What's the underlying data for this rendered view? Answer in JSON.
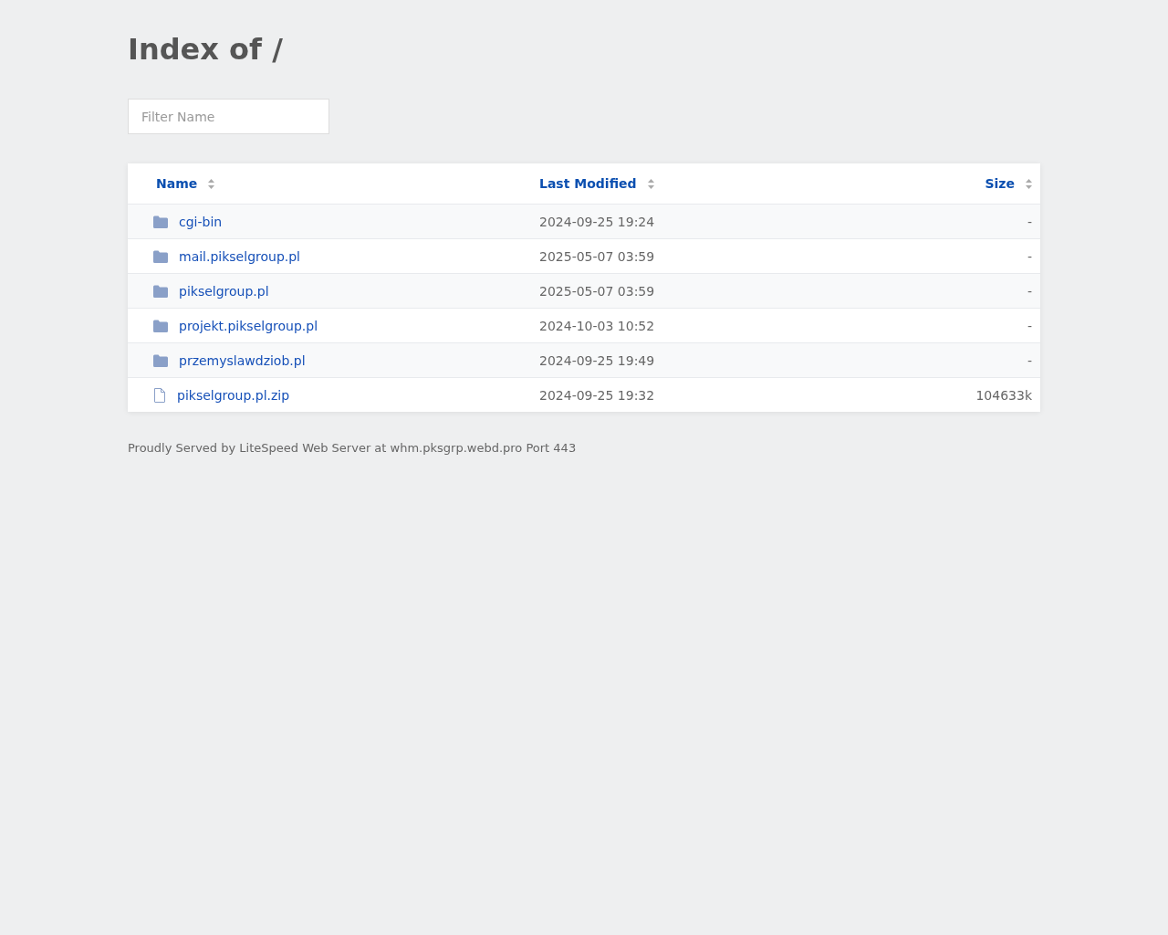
{
  "title": "Index of /",
  "filter": {
    "placeholder": "Filter Name"
  },
  "table": {
    "columns": [
      "Name",
      "Last Modified",
      "Size"
    ],
    "rows": [
      {
        "kind": "folder",
        "name": "cgi-bin",
        "modified": "2024-09-25 19:24",
        "size": "-"
      },
      {
        "kind": "folder",
        "name": "mail.pikselgroup.pl",
        "modified": "2025-05-07 03:59",
        "size": "-"
      },
      {
        "kind": "folder",
        "name": "pikselgroup.pl",
        "modified": "2025-05-07 03:59",
        "size": "-"
      },
      {
        "kind": "folder",
        "name": "projekt.pikselgroup.pl",
        "modified": "2024-10-03 10:52",
        "size": "-"
      },
      {
        "kind": "folder",
        "name": "przemyslawdziob.pl",
        "modified": "2024-09-25 19:49",
        "size": "-"
      },
      {
        "kind": "file",
        "name": "pikselgroup.pl.zip",
        "modified": "2024-09-25 19:32",
        "size": "104633k"
      }
    ]
  },
  "footer": "Proudly Served by LiteSpeed Web Server at whm.pksgrp.webd.pro Port 443"
}
